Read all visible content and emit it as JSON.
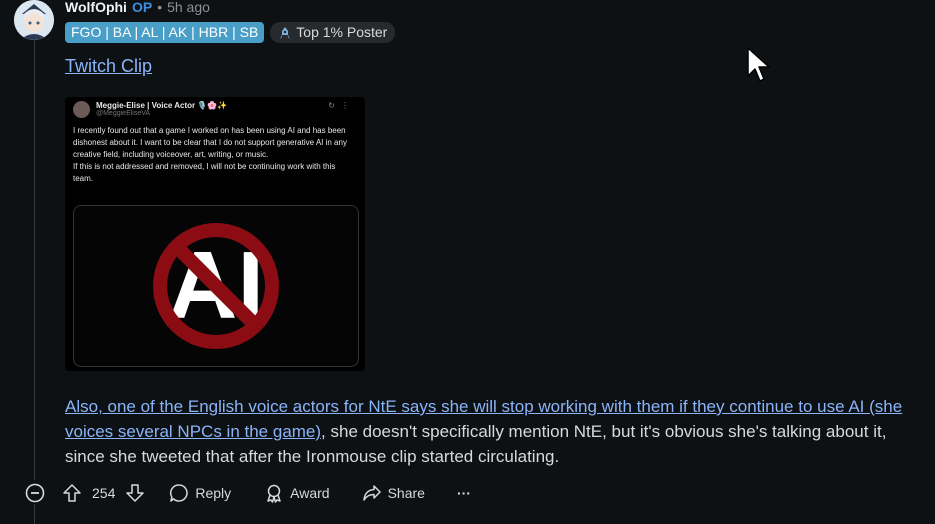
{
  "comment": {
    "username": "WolfOphi",
    "op_badge": "OP",
    "separator": "•",
    "time": "5h ago",
    "flair": "FGO | BA | AL | AK | HBR | SB",
    "top_badge": "Top 1% Poster",
    "twitch_link": "Twitch Clip",
    "embedded_tweet": {
      "name": "Meggie-Elise | Voice Actor 🎙️🌸✨",
      "handle": "@MeggieEliseVA",
      "text": "I recently found out that a game I worked on has been using AI and has been dishonest about it. I want to be clear that I do not support generative AI in any creative field, including voiceover, art, writing, or music.",
      "text2": "If this is not addressed and removed, I will not be continuing work with this team.",
      "media_text": "AI"
    },
    "body_link": "Also, one of the English voice actors for NtE says she will stop working with them if they continue to use AI (she voices several NPCs in the game)",
    "body_rest": ", she doesn't specifically mention NtE, but it's obvious she's talking about it, since she tweeted that after the Ironmouse clip started circulating."
  },
  "actions": {
    "score": "254",
    "reply": "Reply",
    "award": "Award",
    "share": "Share",
    "more": "···"
  },
  "colors": {
    "background": "#0e1113",
    "link": "#8ab4f8",
    "op": "#3d8fe0",
    "flair": "#4a9fc8"
  }
}
